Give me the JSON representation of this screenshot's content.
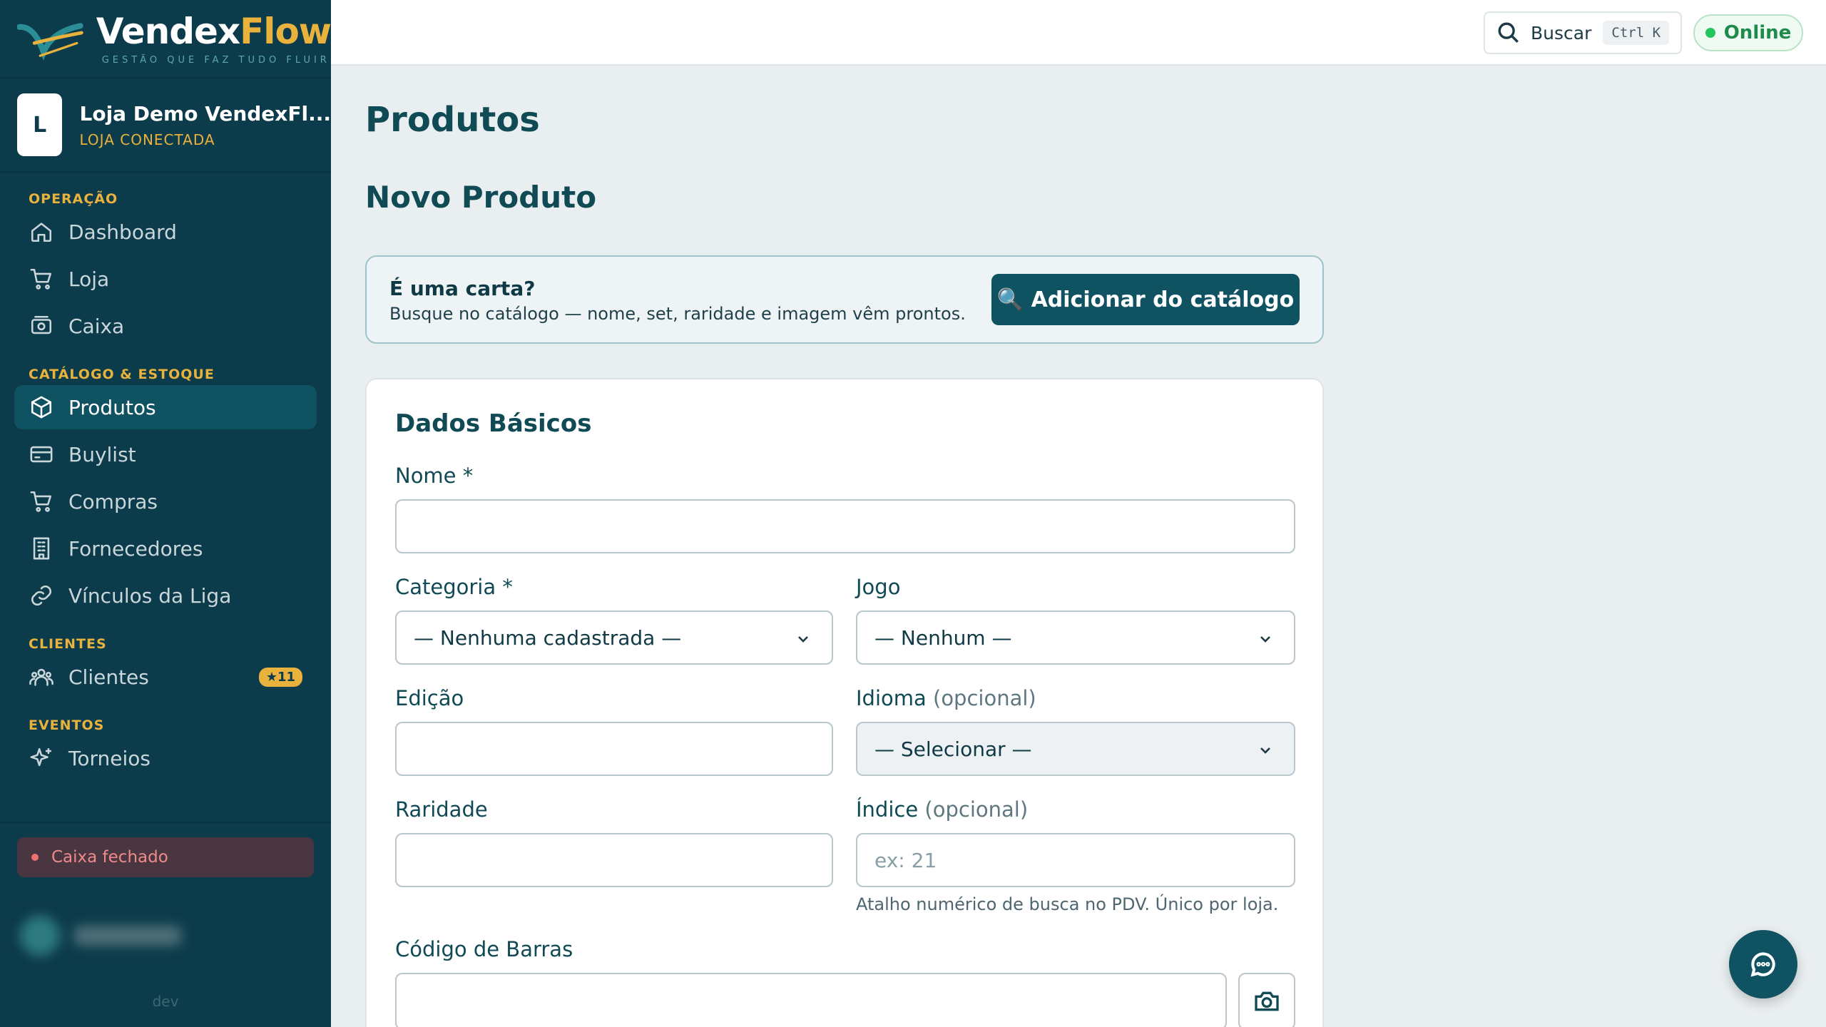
{
  "brand": {
    "name_part1": "Vendex",
    "name_part2": "Flow",
    "tagline": "GESTÃO QUE FAZ TUDO FLUIR"
  },
  "store": {
    "avatar_letter": "L",
    "name": "Loja Demo VendexFl...",
    "status": "LOJA CONECTADA"
  },
  "sidebar": {
    "sections": [
      {
        "label": "OPERAÇÃO"
      },
      {
        "label": "CATÁLOGO & ESTOQUE"
      },
      {
        "label": "CLIENTES"
      },
      {
        "label": "EVENTOS"
      }
    ],
    "items": [
      {
        "label": "Dashboard",
        "icon": "home-icon"
      },
      {
        "label": "Loja",
        "icon": "cart-icon"
      },
      {
        "label": "Caixa",
        "icon": "cash-register-icon"
      },
      {
        "label": "Produtos",
        "icon": "box-icon",
        "active": true
      },
      {
        "label": "Buylist",
        "icon": "card-icon"
      },
      {
        "label": "Compras",
        "icon": "cart-icon"
      },
      {
        "label": "Fornecedores",
        "icon": "building-icon"
      },
      {
        "label": "Vínculos da Liga",
        "icon": "link-icon"
      },
      {
        "label": "Clientes",
        "icon": "users-icon",
        "badge": "★11"
      },
      {
        "label": "Torneios",
        "icon": "sparkles-icon"
      }
    ],
    "cash_status": "Caixa fechado",
    "env": "dev"
  },
  "topbar": {
    "search_label": "Buscar",
    "search_shortcut": "Ctrl K",
    "status": "Online"
  },
  "main": {
    "page_title": "Produtos",
    "section_title": "Novo Produto",
    "card_prompt": {
      "title": "É uma carta?",
      "description": "Busque no catálogo — nome, set, raridade e imagem vêm prontos.",
      "button": "🔍 Adicionar do catálogo"
    },
    "form": {
      "title": "Dados Básicos",
      "nome_label": "Nome *",
      "nome_value": "",
      "categoria_label": "Categoria *",
      "categoria_value": "— Nenhuma cadastrada —",
      "jogo_label": "Jogo",
      "jogo_value": "— Nenhum —",
      "edicao_label": "Edição",
      "edicao_value": "",
      "idioma_label": "Idioma",
      "idioma_optional": "(opcional)",
      "idioma_value": "— Selecionar —",
      "raridade_label": "Raridade",
      "raridade_value": "",
      "indice_label": "Índice",
      "indice_optional": "(opcional)",
      "indice_placeholder": "ex: 21",
      "indice_hint": "Atalho numérico de busca no PDV. Único por loja.",
      "barcode_label": "Código de Barras",
      "barcode_value": ""
    }
  },
  "colors": {
    "sidebar_bg": "#0c3b4b",
    "accent": "#0f5363",
    "brand_gold": "#e8b23c",
    "online_green": "#22c55e",
    "danger": "#f07070"
  }
}
